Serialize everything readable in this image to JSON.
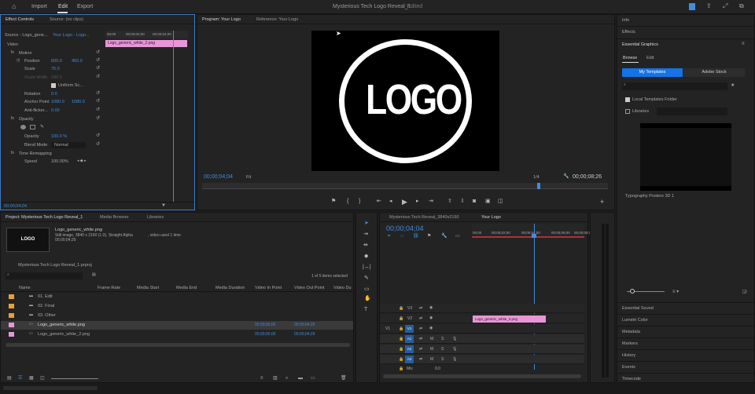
{
  "topbar": {
    "import": "Import",
    "edit": "Edit",
    "export": "Export",
    "title": "Mysterious Tech Logo Reveal_1",
    "edited": "- Edited"
  },
  "effect": {
    "tab1": "Effect Controls",
    "tab2": "Source: (no clips)",
    "source": "Source - Logo_gene...",
    "seq": "Your Logo - Logo...",
    "ruler1": "00;00",
    "ruler2": "00;00;02;00",
    "ruler3": "00;00;04;00",
    "clip": "Logo_generic_white_2.png",
    "video": "Video",
    "motion": "Motion",
    "position": "Position",
    "posx": "600.0",
    "posy": "450.0",
    "scale": "Scale",
    "scalev": "75.0",
    "scalew": "Scale Width",
    "scalewv": "100.0",
    "uniform": "Uniform Sc...",
    "rotation": "Rotation",
    "rotv": "0.0",
    "anchor": "Anchor Point",
    "ax": "1080.0",
    "ay": "1080.0",
    "antiflicker": "Anti-flicker...",
    "afv": "0.00",
    "opacity": "Opacity",
    "opv": "100.0 %",
    "blend": "Blend Mode",
    "blendv": "Normal",
    "timeremap": "Time Remapping",
    "speed": "Speed",
    "speedv": "100.00%",
    "tc": "00;00;04;04"
  },
  "program": {
    "tab1": "Program: Your Logo",
    "tab2": "Reference: Your Logo",
    "logo": "LOGO",
    "tc": "00;00;04;04",
    "fit": "Fit",
    "res": "1/4",
    "dur": "00;00;08;26"
  },
  "project": {
    "tab1": "Project: Mysterious Tech Logo Reveal_1",
    "tab2": "Media Browser",
    "tab3": "Libraries",
    "thumb": "LOGO",
    "fname": "Logo_generic_white.png",
    "info1": "Still image, 3840 x 2160 (1.0), Straight Alpha",
    "info2": ", video used 1 time",
    "info3": "00;00;04;29",
    "prj": "Mysterious Tech Logo Reveal_1.prproj",
    "items": "1 of 5 items selected",
    "cols": [
      "Name",
      "Frame Rate",
      "Media Start",
      "Media End",
      "Media Duration",
      "Video In Point",
      "Video Out Point",
      "Video Du"
    ],
    "rows": [
      {
        "name": "01. Edit",
        "in": "",
        "out": ""
      },
      {
        "name": "02. Final",
        "in": "",
        "out": ""
      },
      {
        "name": "03. Other",
        "in": "",
        "out": ""
      },
      {
        "name": "Logo_generic_white.png",
        "in": "00;00;00;00",
        "out": "00;00;04;29"
      },
      {
        "name": "Logo_generic_white_2.png",
        "in": "00;00;00;00",
        "out": "00;00;04;29"
      }
    ]
  },
  "timeline": {
    "tab1": "Mysterious Tech Reveal_3840x2160",
    "tab2": "Your Logo",
    "tc": "00;00;04;04",
    "r0": "00;00",
    "r1": "00;00;02;00",
    "r2": "00;00;04;00",
    "r3": "00;00;06;00",
    "r4": "00;00;08;00",
    "clip": "Logo_generic_white_2.png",
    "v3": "V3",
    "v2": "V2",
    "v1": "V1",
    "a1": "A1",
    "a2": "A2",
    "a3": "A3",
    "mix": "Mix",
    "mixv": "0.0",
    "m": "M",
    "s": "S"
  },
  "right": {
    "info": "Info",
    "effects": "Effects",
    "eg": "Essential Graphics",
    "browse": "Browse",
    "editt": "Edit",
    "mytpl": "My Templates",
    "stock": "Adobe Stock",
    "local": "Local Templates Folder",
    "libs": "Libraries",
    "tpl": "Typography Posters 3D 1",
    "panels": [
      "Essential Sound",
      "Lumetri Color",
      "Metadata",
      "Markers",
      "History",
      "Events",
      "Timecode"
    ]
  }
}
